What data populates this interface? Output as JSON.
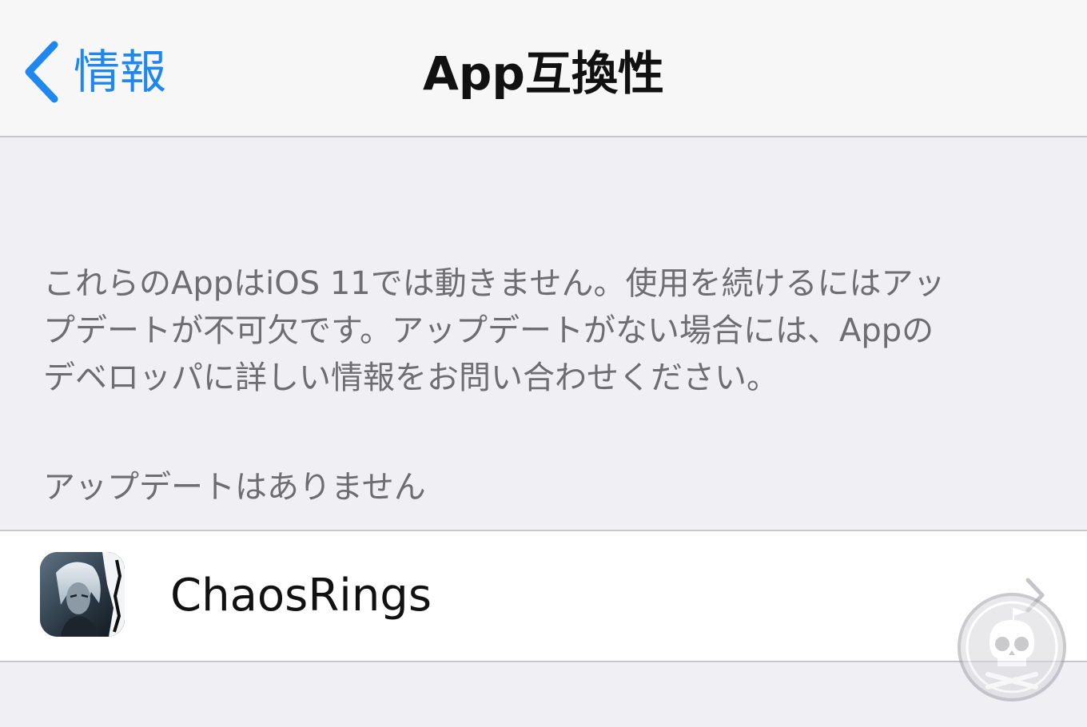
{
  "navbar": {
    "back_label": "情報",
    "title": "App互換性"
  },
  "info": {
    "lines": [
      "これらのAppはiOS 11では動きません。使用を続けるにはアッ",
      "プデートが不可欠です。アップデートがない場合には、Appの",
      "デベロッパに詳しい情報をお問い合わせください。"
    ]
  },
  "section": {
    "header": "アップデートはありません"
  },
  "apps": [
    {
      "name": "ChaosRings",
      "icon": "chaos-rings-app-icon"
    }
  ],
  "colors": {
    "accent": "#1e88f0",
    "background": "#efeff4",
    "navbar": "#f7f7f8",
    "secondary_text": "#6d6d72",
    "separator": "#c8c7cc"
  }
}
